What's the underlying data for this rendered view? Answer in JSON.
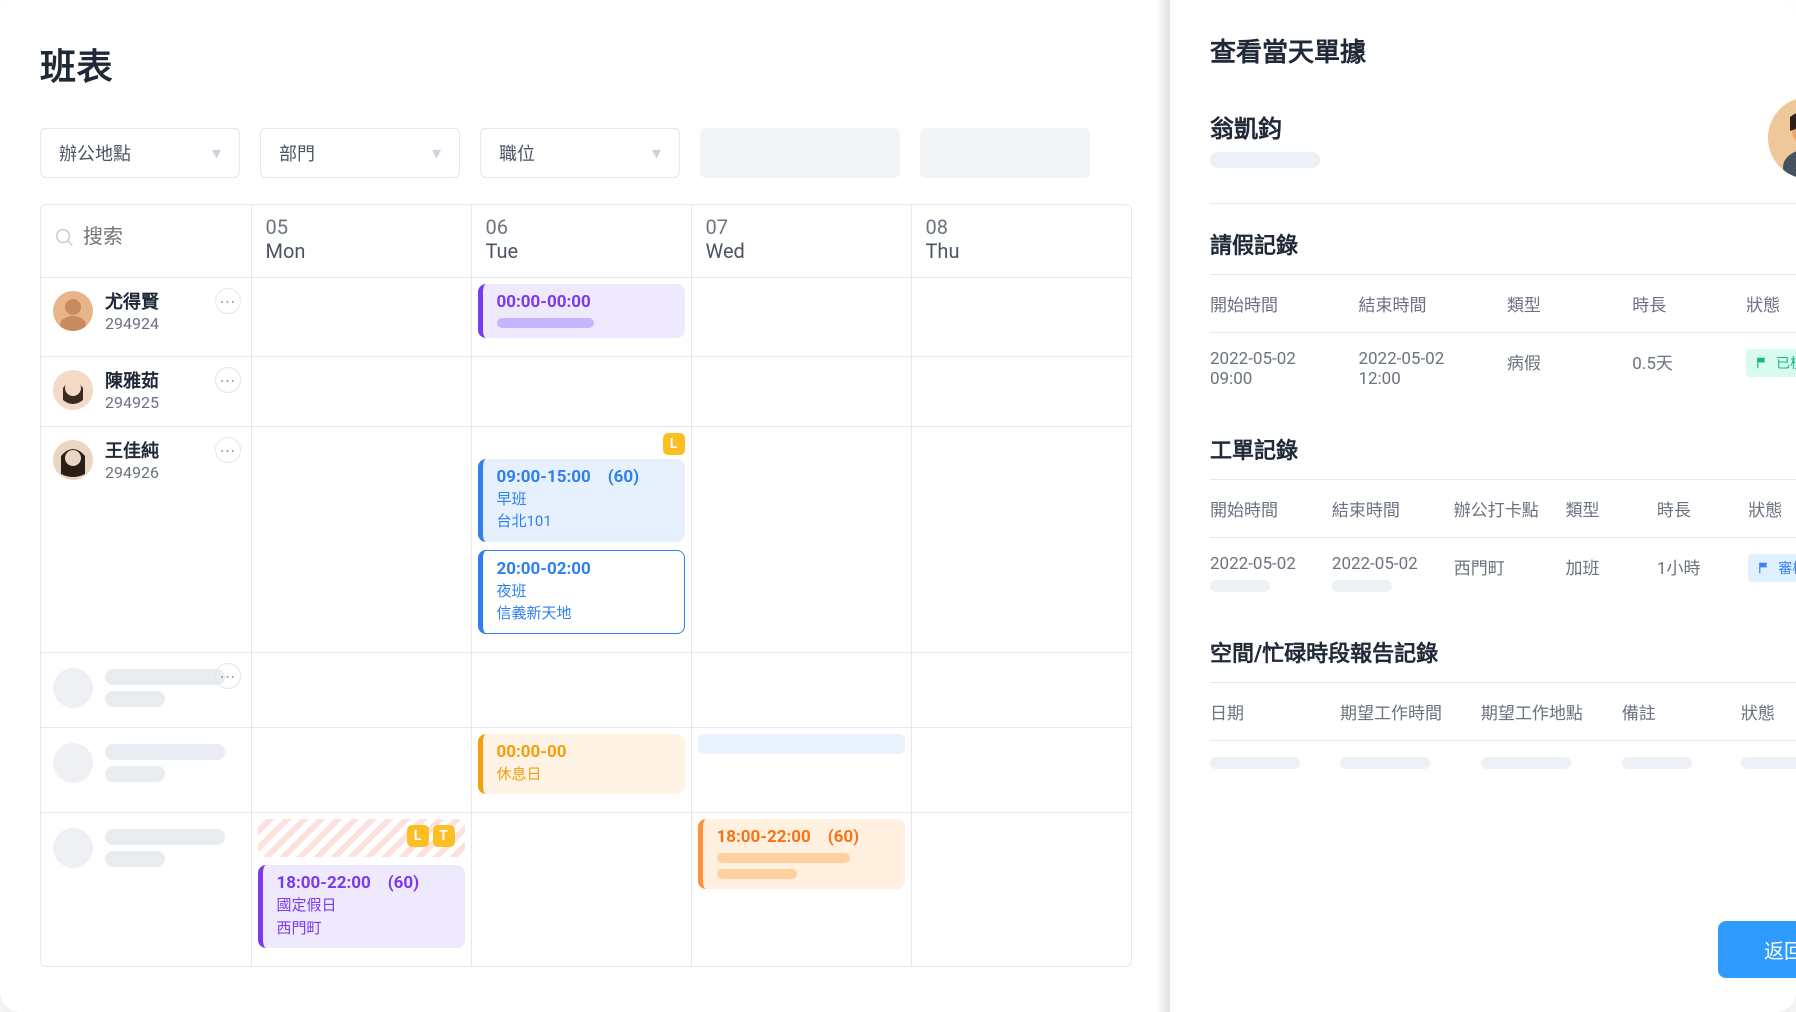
{
  "page": {
    "title": "班表"
  },
  "filters": {
    "location": "辦公地點",
    "department": "部門",
    "position": "職位"
  },
  "search": {
    "placeholder": "搜索"
  },
  "days": [
    {
      "num": "05",
      "name": "Mon"
    },
    {
      "num": "06",
      "name": "Tue"
    },
    {
      "num": "07",
      "name": "Wed"
    },
    {
      "num": "08",
      "name": "Thu"
    }
  ],
  "employees": [
    {
      "name": "尤得賢",
      "id": "294924"
    },
    {
      "name": "陳雅茹",
      "id": "294925"
    },
    {
      "name": "王佳純",
      "id": "294926"
    }
  ],
  "shifts": {
    "emp0_tue": {
      "time": "00:00-00:00"
    },
    "emp2_tue_a": {
      "time": "09:00-15:00",
      "break": "(60)",
      "name": "早班",
      "loc": "台北101"
    },
    "emp2_tue_b": {
      "time": "20:00-02:00",
      "name": "夜班",
      "loc": "信義新天地"
    },
    "ghost_tue": {
      "time": "00:00-00",
      "name": "休息日"
    },
    "ghost_mon": {
      "time": "18:00-22:00",
      "break": "(60)",
      "name": "國定假日",
      "loc": "西門町"
    },
    "ghost_wed": {
      "time": "18:00-22:00",
      "break": "(60)"
    },
    "badges": {
      "l": "L",
      "t": "T"
    }
  },
  "detail": {
    "panel_title": "查看當天單據",
    "person_name": "翁凱鈞",
    "leave": {
      "section": "請假記錄",
      "headers": {
        "start": "開始時間",
        "end": "結束時間",
        "type": "類型",
        "duration": "時長",
        "status": "狀態"
      },
      "row": {
        "start_date": "2022-05-02",
        "start_time": "09:00",
        "end_date": "2022-05-02",
        "end_time": "12:00",
        "type": "病假",
        "duration": "0.5天",
        "status": "已核准"
      }
    },
    "work": {
      "section": "工單記錄",
      "headers": {
        "start": "開始時間",
        "end": "結束時間",
        "loc": "辦公打卡點",
        "type": "類型",
        "duration": "時長",
        "status": "狀態"
      },
      "row": {
        "start_date": "2022-05-02",
        "end_date": "2022-05-02",
        "loc": "西門町",
        "type": "加班",
        "duration": "1小時",
        "status": "審核中"
      }
    },
    "avail": {
      "section": "空間/忙碌時段報告記錄",
      "headers": {
        "date": "日期",
        "hours": "期望工作時間",
        "loc": "期望工作地點",
        "note": "備註",
        "status": "狀態"
      }
    },
    "back": "返回"
  }
}
